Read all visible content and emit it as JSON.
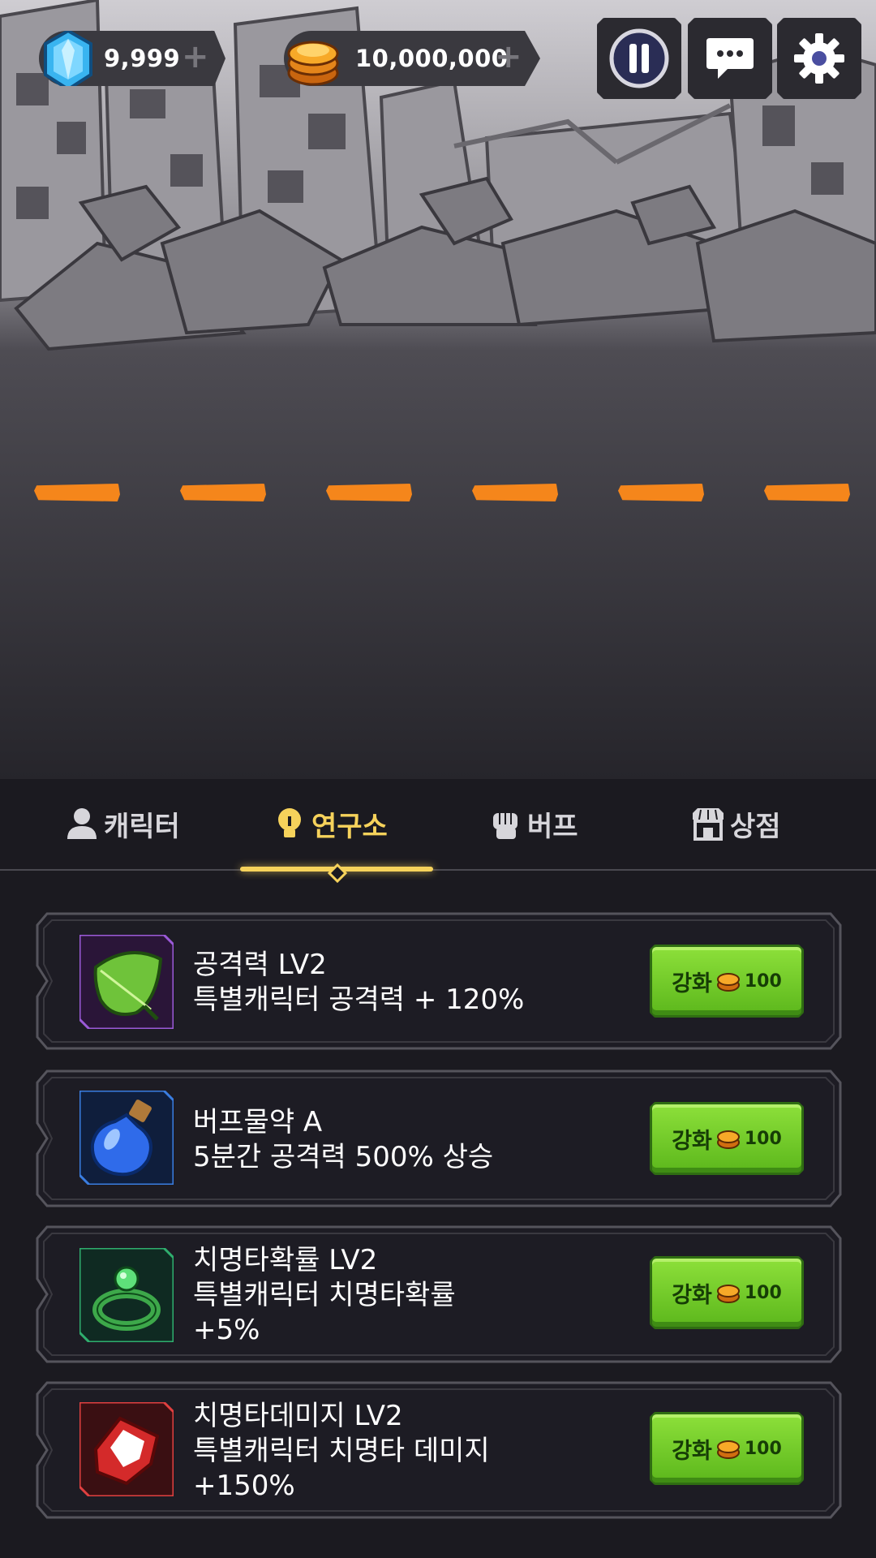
{
  "hud": {
    "gems": "9,999",
    "gem_plus": "+",
    "coins": "10,000,000",
    "coin_plus": "+",
    "icons": [
      "gem-icon",
      "coin-stack-icon",
      "pause-icon",
      "chat-icon",
      "settings-gear-icon"
    ]
  },
  "tabs": [
    {
      "label": "캐릭터",
      "icon": "person-icon",
      "active": false
    },
    {
      "label": "연구소",
      "icon": "lightbulb-icon",
      "active": true
    },
    {
      "label": "버프",
      "icon": "fist-icon",
      "active": false
    },
    {
      "label": "상점",
      "icon": "shop-icon",
      "active": false
    }
  ],
  "research": [
    {
      "title": "공격력 LV2",
      "desc": [
        "특별캐릭터 공격력 + 120%"
      ],
      "icon": "leaf-icon",
      "button": "강화",
      "cost": "100"
    },
    {
      "title": "버프물약 A",
      "desc": [
        "5분간 공격력 500% 상승"
      ],
      "icon": "potion-icon",
      "button": "강화",
      "cost": "100"
    },
    {
      "title": "치명타확률 LV2",
      "desc": [
        "특별캐릭터 치명타확률",
        "+5%"
      ],
      "icon": "ring-icon",
      "button": "강화",
      "cost": "100"
    },
    {
      "title": "치명타데미지 LV2",
      "desc": [
        "특별캐릭터 치명타 데미지",
        "+150%"
      ],
      "icon": "ruby-icon",
      "button": "강화",
      "cost": "100"
    }
  ],
  "colors": {
    "accent": "#f6d25b",
    "road_dash": "#f5861b",
    "button_green": "#74cc2a",
    "background": "#1b1a20"
  }
}
